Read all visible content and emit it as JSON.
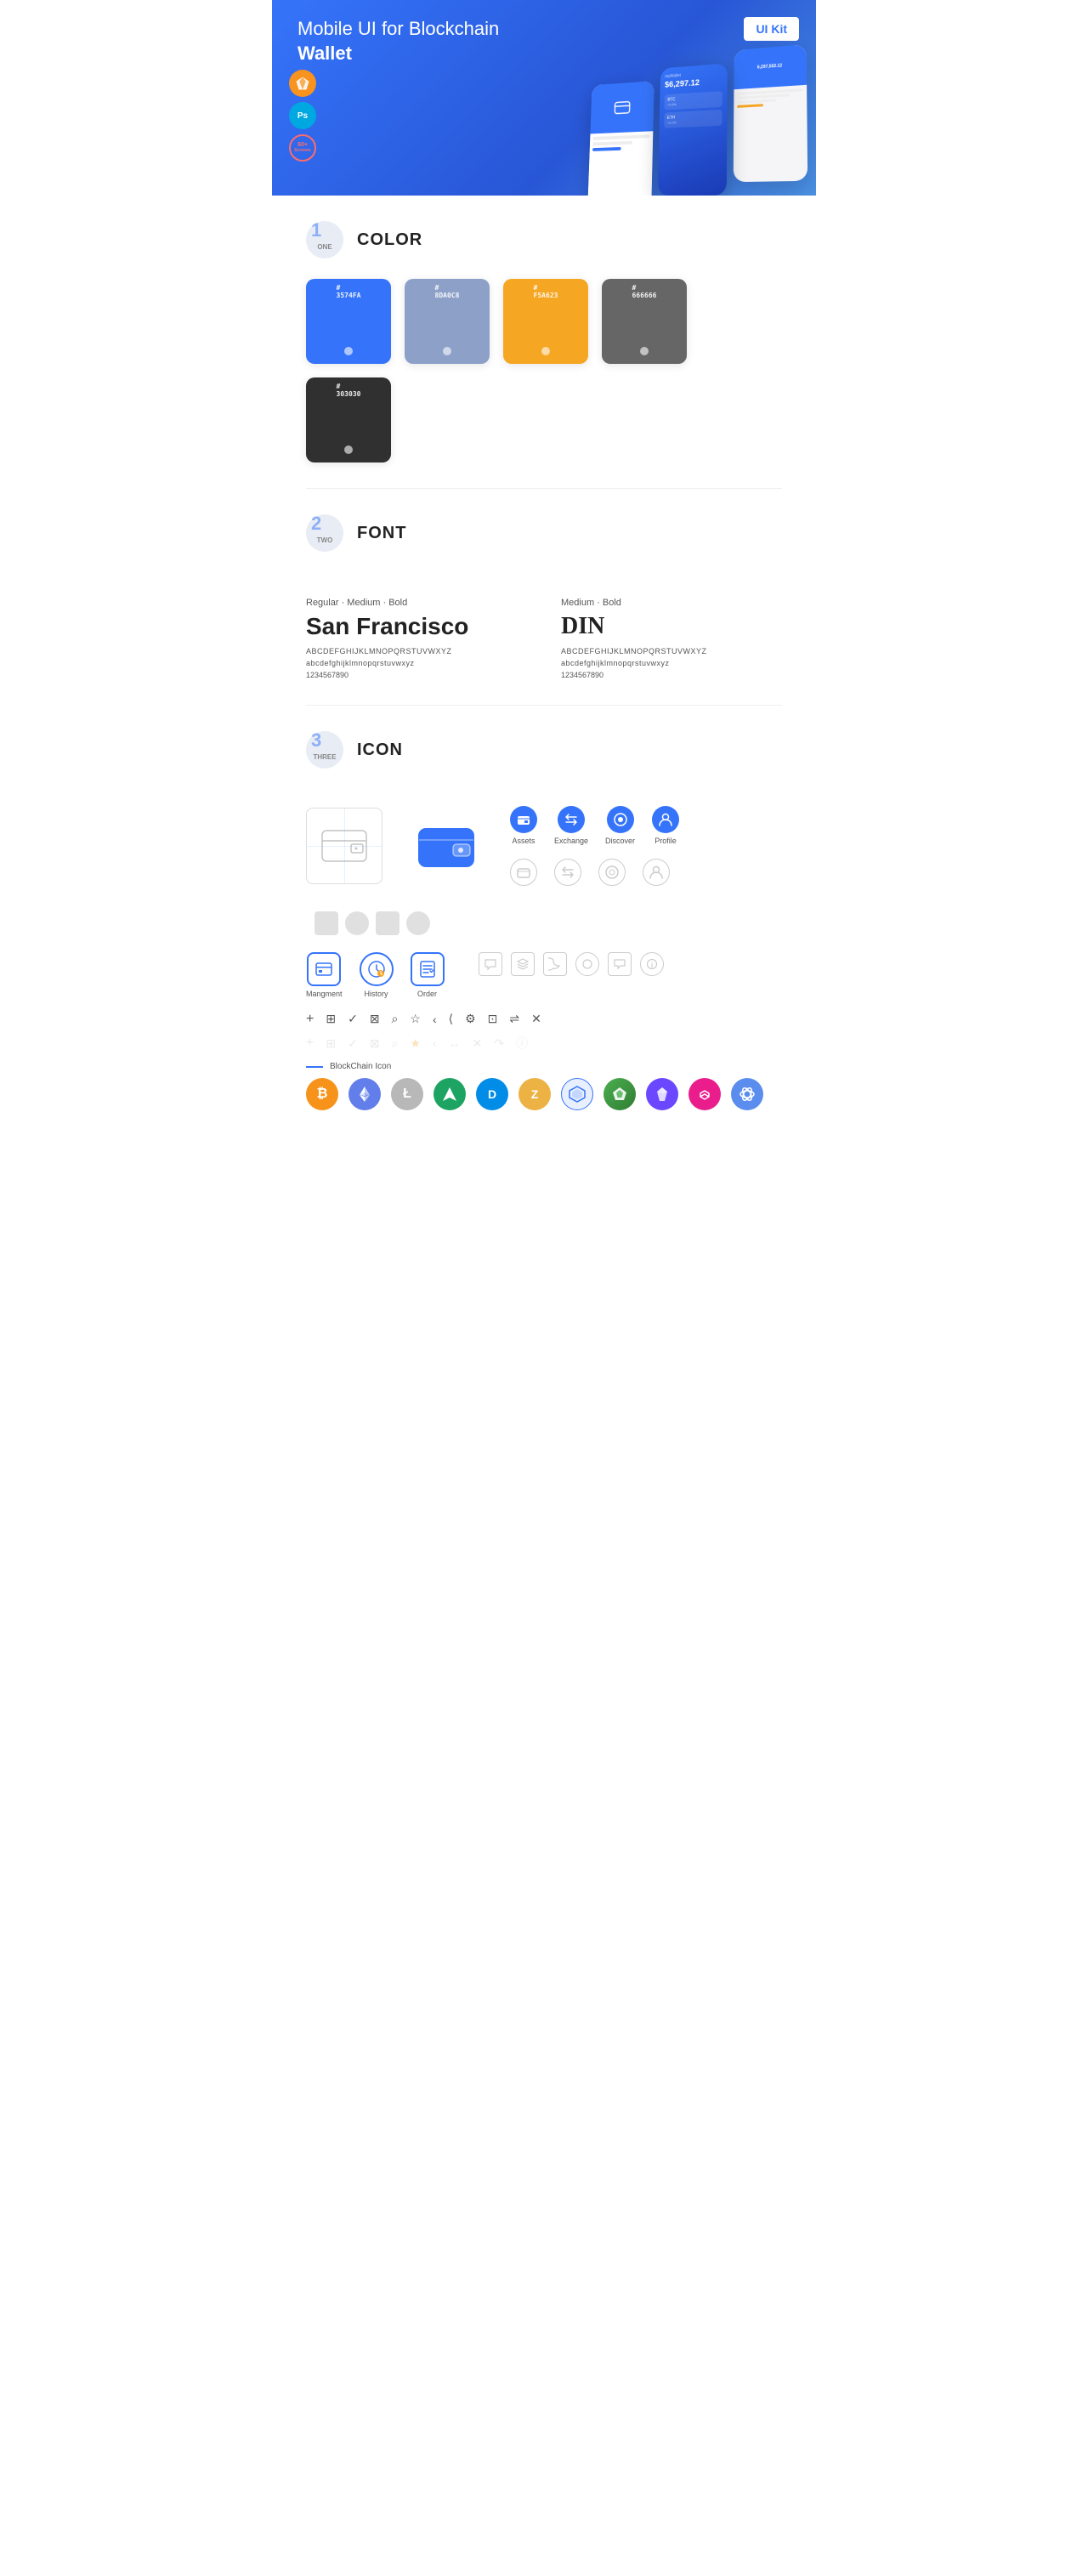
{
  "hero": {
    "title": "Mobile UI for Blockchain ",
    "title_bold": "Wallet",
    "badge": "UI Kit",
    "sketch_label": "Sk",
    "ps_label": "Ps",
    "screens_top": "60+",
    "screens_bottom": "Screens"
  },
  "sections": {
    "color": {
      "number": "1",
      "number_text": "ONE",
      "label": "COLOR",
      "swatches": [
        {
          "hex": "#3574FA",
          "code": "#\n3574FA"
        },
        {
          "hex": "#8DA0C8",
          "code": "#\n8DA0C8"
        },
        {
          "hex": "#F5A623",
          "code": "#\nF5A623"
        },
        {
          "hex": "#666666",
          "code": "#\n666666"
        },
        {
          "hex": "#303030",
          "code": "#\n303030"
        }
      ]
    },
    "font": {
      "number": "2",
      "number_text": "TWO",
      "label": "FONT",
      "fonts": [
        {
          "style": "Regular · Medium · Bold",
          "name": "San Francisco",
          "upper": "ABCDEFGHIJKLMNOPQRSTUVWXYZ",
          "lower": "abcdefghijklmnopqrstuvwxyz",
          "nums": "1234567890"
        },
        {
          "style": "Medium · Bold",
          "name": "DIN",
          "upper": "ABCDEFGHIJKLMNOPQRSTUVWXYZ",
          "lower": "abcdefghijklmnopqrstuvwxyz",
          "nums": "1234567890"
        }
      ]
    },
    "icon": {
      "number": "3",
      "number_text": "THREE",
      "label": "ICON",
      "tab_icons": [
        {
          "label": "Assets"
        },
        {
          "label": "Exchange"
        },
        {
          "label": "Discover"
        },
        {
          "label": "Profile"
        }
      ],
      "mgmt_icons": [
        {
          "label": "Mangment"
        },
        {
          "label": "History"
        },
        {
          "label": "Order"
        }
      ],
      "small_icons": [
        "+",
        "⊞",
        "✓",
        "⊠",
        "⌕",
        "☆",
        "‹",
        "≺",
        "⚙",
        "⊡",
        "⇌",
        "✕"
      ],
      "blockchain_label": "BlockChain Icon",
      "crypto_coins": [
        {
          "symbol": "₿",
          "color": "#F7931A",
          "name": "Bitcoin"
        },
        {
          "symbol": "Ξ",
          "color": "#627EEA",
          "name": "Ethereum"
        },
        {
          "symbol": "Ł",
          "color": "#B8B8B8",
          "name": "Litecoin"
        },
        {
          "symbol": "◆",
          "color": "#1DA462",
          "name": "Waves"
        },
        {
          "symbol": "D",
          "color": "#008CE7",
          "name": "Dash"
        },
        {
          "symbol": "Z",
          "color": "#ECB244",
          "name": "Zcash"
        },
        {
          "symbol": "◈",
          "color": "#3574FA",
          "name": "Blockchain"
        },
        {
          "symbol": "▲",
          "color": "#4CAF50",
          "name": "Augur"
        },
        {
          "symbol": "◇",
          "color": "#6B48FF",
          "name": "Crypto"
        },
        {
          "symbol": "⬡",
          "color": "#E91E8C",
          "name": "Polygon"
        },
        {
          "symbol": "●",
          "color": "#5B8DEF",
          "name": "Coin"
        }
      ]
    }
  }
}
